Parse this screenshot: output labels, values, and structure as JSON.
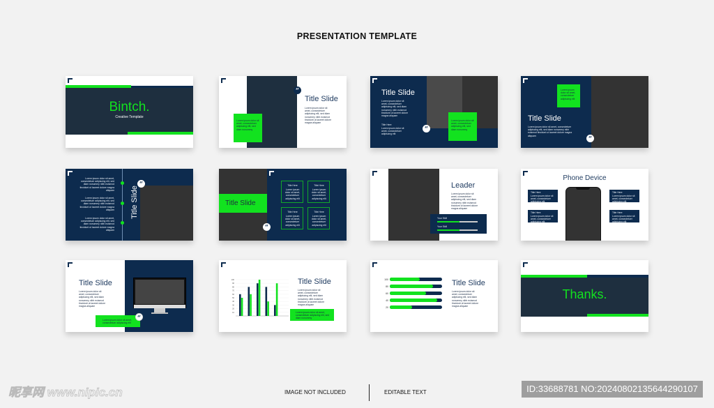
{
  "header": {
    "title": "PRESENTATION TEMPLATE"
  },
  "lorem": {
    "short": "Lorem ipsum dolor sit amet, consectetuer adipiscing elit",
    "medium": "Lorem ipsum dolor sit amet, consectetuer adipiscing elit, sed diam nonummy",
    "long": "Lorem ipsum dolor sit amet, consectetuer adipiscing elit, sed diam nonummy nibh euismod tincidunt ut laoreet dolore magna aliquam"
  },
  "slides": {
    "s1": {
      "title": "Bintch.",
      "subtitle": "Creative Template"
    },
    "s2": {
      "title": "Title Slide"
    },
    "s3": {
      "title": "Title Slide",
      "sub_title": "Title Here"
    },
    "s4": {
      "title": "Title Slide"
    },
    "s5": {
      "title": "Title Slide"
    },
    "s6": {
      "title": "Title Slide",
      "box_title": "Title Here"
    },
    "s7": {
      "title": "Leader",
      "skills": [
        {
          "label": "Your Skill",
          "level": 0.55
        },
        {
          "label": "Your Skill",
          "level": 0.55
        }
      ]
    },
    "s8": {
      "title": "Phone Device",
      "box_title": "Title Here"
    },
    "s9": {
      "title": "Title Slide"
    },
    "s10": {
      "title": "Title Slide"
    },
    "s11": {
      "title": "Title Slide"
    },
    "s12": {
      "title": "Thanks."
    }
  },
  "chart_data": [
    {
      "type": "bar",
      "yticks": [
        10,
        20,
        30,
        40,
        50,
        60,
        70,
        80,
        90,
        100
      ],
      "ylim": [
        0,
        100
      ],
      "series": [
        {
          "values": [
            60,
            80,
            90,
            80,
            30
          ],
          "color": "#0d2b4e"
        },
        {
          "values": [
            50,
            60,
            100,
            40,
            90
          ],
          "color": "#12e21f"
        }
      ]
    },
    {
      "type": "bar",
      "orientation": "horizontal",
      "categories": [
        "100",
        "80",
        "60",
        "40",
        "20"
      ],
      "values": [
        57,
        82,
        69,
        90,
        43
      ],
      "colors": {
        "fill": "#12e21f",
        "track": "#0d2b4e"
      }
    }
  ],
  "footer": {
    "watermark": "昵享网 www.nipic.cn",
    "left": "IMAGE NOT INCLUDED",
    "right": "EDITABLE TEXT",
    "id": "ID:33688781 NO:20240802135644290107"
  },
  "colors": {
    "navy": "#0d2b4e",
    "dark": "#1e2f3f",
    "green": "#12e21f",
    "gray": "#333333"
  }
}
